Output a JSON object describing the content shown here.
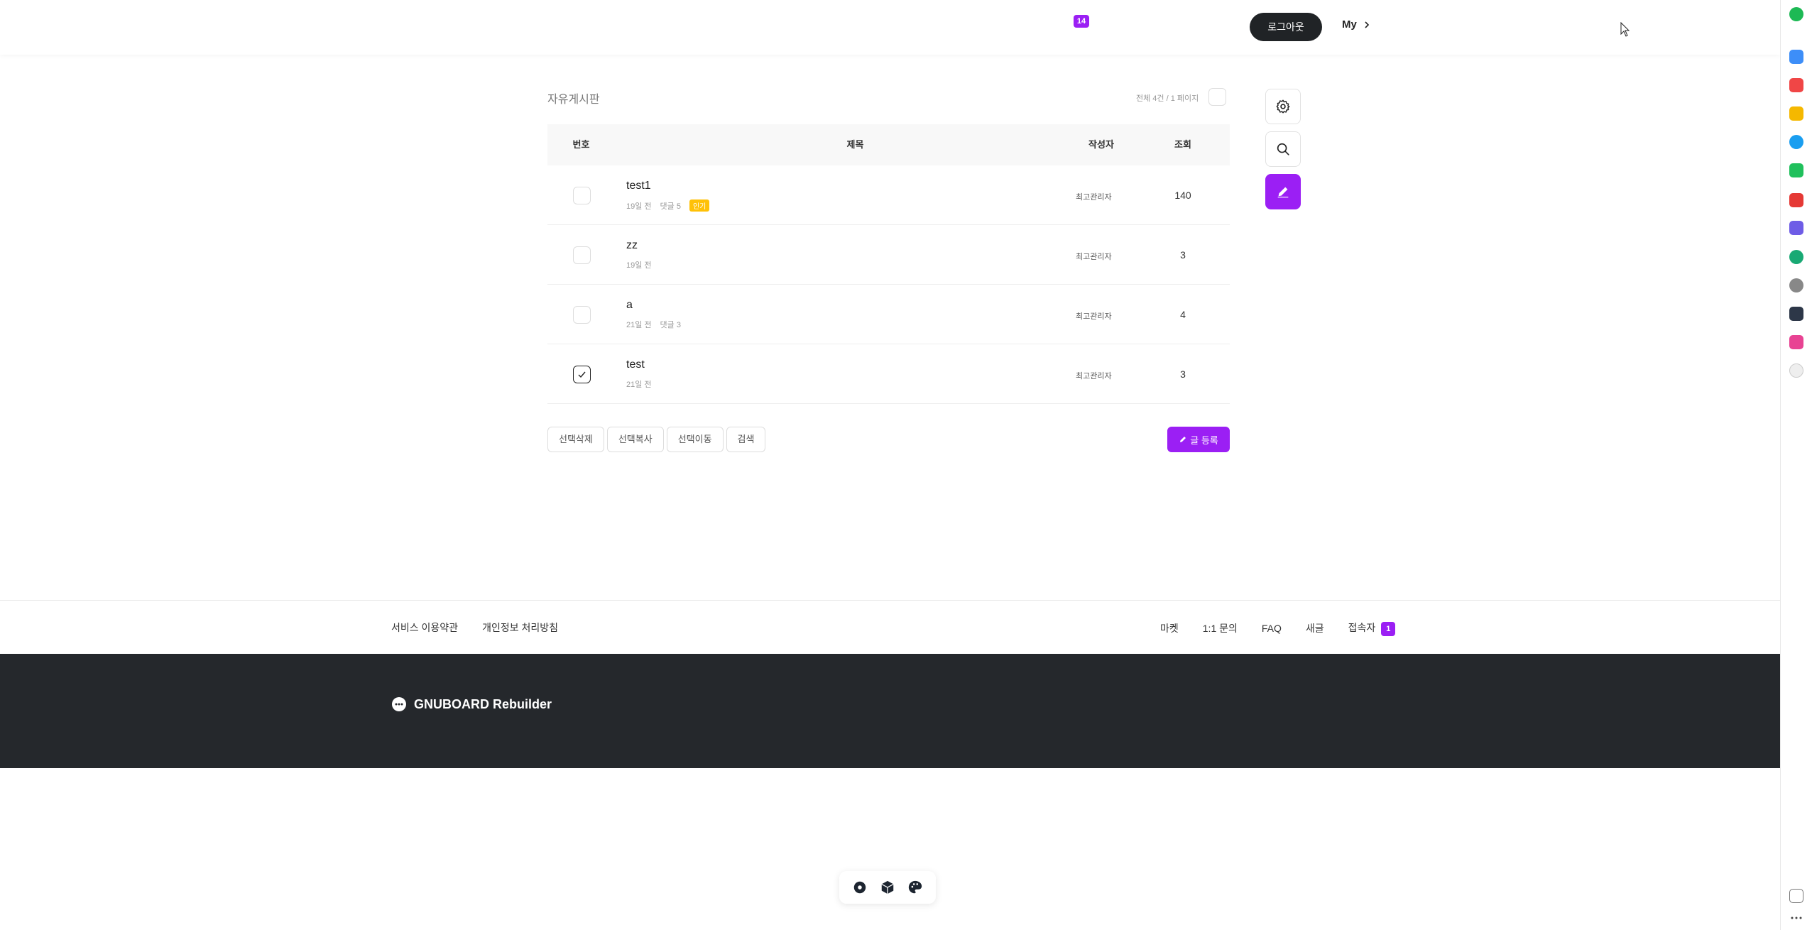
{
  "header": {
    "notification_count": "14",
    "logout_label": "로그아웃",
    "my_label": "My"
  },
  "board": {
    "title": "자유게시판",
    "page_info": "전체 4건 / 1 페이지",
    "columns": {
      "num": "번호",
      "title": "제목",
      "writer": "작성자",
      "hits": "조회"
    },
    "rows": [
      {
        "subject": "test1",
        "date": "19일 전",
        "comments": "댓글 5",
        "hot": "인기",
        "writer": "최고관리자",
        "hits": "140",
        "checked": false
      },
      {
        "subject": "zz",
        "date": "19일 전",
        "comments": "",
        "hot": "",
        "writer": "최고관리자",
        "hits": "3",
        "checked": false
      },
      {
        "subject": "a",
        "date": "21일 전",
        "comments": "댓글 3",
        "hot": "",
        "writer": "최고관리자",
        "hits": "4",
        "checked": false
      },
      {
        "subject": "test",
        "date": "21일 전",
        "comments": "",
        "hot": "",
        "writer": "최고관리자",
        "hits": "3",
        "checked": true
      }
    ],
    "actions": {
      "delete": "선택삭제",
      "copy": "선택복사",
      "move": "선택이동",
      "search": "검색"
    },
    "write_label": "글 등록"
  },
  "side_buttons": {
    "settings_icon": "gear-icon",
    "search_icon": "search-icon",
    "write_icon": "pencil-icon"
  },
  "footer": {
    "left_links": [
      "서비스 이용약관",
      "개인정보 처리방침"
    ],
    "right_links": [
      "마켓",
      "1:1 문의",
      "FAQ",
      "새글"
    ],
    "visitor_label": "접속자",
    "visitor_count": "1",
    "brand": "GNUBOARD Rebuilder"
  },
  "toolbar": {
    "icons": [
      "gear-icon",
      "cube-icon",
      "palette-icon"
    ]
  },
  "colors": {
    "accent": "#9b1ff4",
    "dark": "#25282c",
    "hot": "#ffc107"
  }
}
